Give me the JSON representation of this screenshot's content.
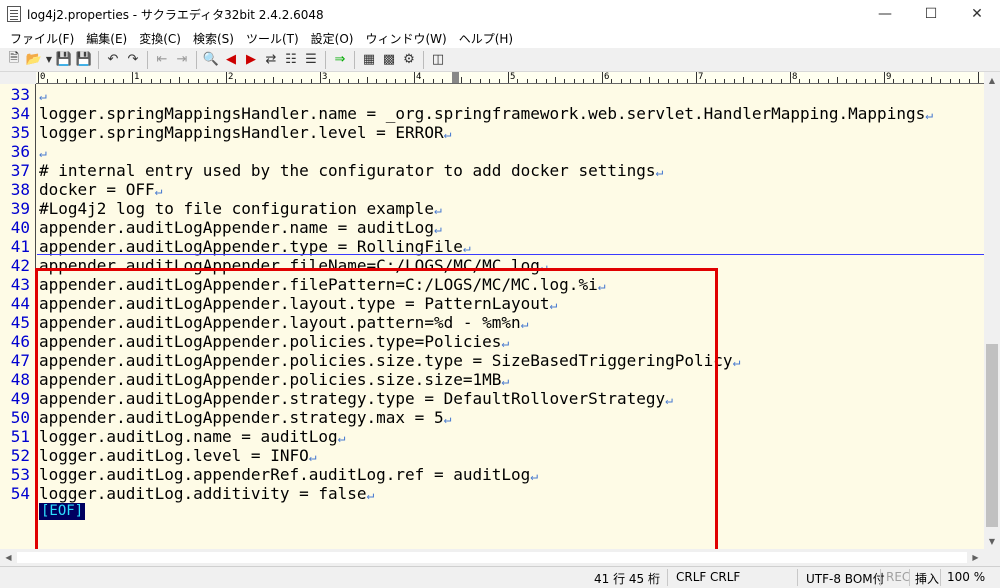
{
  "window": {
    "title": "log4j2.properties - サクラエディタ32bit 2.4.2.6048",
    "minimize_icon": "minimize-icon",
    "maximize_icon": "maximize-icon",
    "close_icon": "close-icon"
  },
  "menu": [
    {
      "label": "ファイル(F)"
    },
    {
      "label": "編集(E)"
    },
    {
      "label": "変換(C)"
    },
    {
      "label": "検索(S)"
    },
    {
      "label": "ツール(T)"
    },
    {
      "label": "設定(O)"
    },
    {
      "label": "ウィンドウ(W)"
    },
    {
      "label": "ヘルプ(H)"
    }
  ],
  "toolbar": {
    "icons": [
      "new-file-icon",
      "open-file-icon",
      "dropdown-icon",
      "save-icon",
      "save-as-icon",
      "undo-icon",
      "redo-icon",
      "jump-back-icon",
      "jump-forward-icon",
      "search-icon",
      "search-prev-icon",
      "search-next-icon",
      "replace-icon",
      "grep-icon",
      "outline-icon",
      "compare-icon",
      "function-list-icon",
      "tag-jump-icon",
      "settings-icon"
    ]
  },
  "ruler": {
    "labels": [
      "0",
      "1",
      "2",
      "3",
      "4",
      "5",
      "6",
      "7",
      "8",
      "9"
    ]
  },
  "editor": {
    "eof_label": "[EOF]",
    "crlf_mark": "↵",
    "lines": [
      {
        "num": "33",
        "text": ""
      },
      {
        "num": "34",
        "text": "logger.springMappingsHandler.name = _org.springframework.web.servlet.HandlerMapping.Mappings"
      },
      {
        "num": "35",
        "text": "logger.springMappingsHandler.level = ERROR"
      },
      {
        "num": "36",
        "text": ""
      },
      {
        "num": "37",
        "text": "# internal entry used by the configurator to add docker settings"
      },
      {
        "num": "38",
        "text": "docker = OFF"
      },
      {
        "num": "39",
        "text": "#Log4j2 log to file configuration example"
      },
      {
        "num": "40",
        "text": "appender.auditLogAppender.name = auditLog"
      },
      {
        "num": "41",
        "text": "appender.auditLogAppender.type = RollingFile"
      },
      {
        "num": "42",
        "text": "appender.auditLogAppender.fileName=C:/LOGS/MC/MC.log"
      },
      {
        "num": "43",
        "text": "appender.auditLogAppender.filePattern=C:/LOGS/MC/MC.log.%i"
      },
      {
        "num": "44",
        "text": "appender.auditLogAppender.layout.type = PatternLayout"
      },
      {
        "num": "45",
        "text": "appender.auditLogAppender.layout.pattern=%d - %m%n"
      },
      {
        "num": "46",
        "text": "appender.auditLogAppender.policies.type=Policies"
      },
      {
        "num": "47",
        "text": "appender.auditLogAppender.policies.size.type = SizeBasedTriggeringPolicy"
      },
      {
        "num": "48",
        "text": "appender.auditLogAppender.policies.size.size=1MB"
      },
      {
        "num": "49",
        "text": "appender.auditLogAppender.strategy.type = DefaultRolloverStrategy"
      },
      {
        "num": "50",
        "text": "appender.auditLogAppender.strategy.max = 5"
      },
      {
        "num": "51",
        "text": "logger.auditLog.name = auditLog"
      },
      {
        "num": "52",
        "text": "logger.auditLog.level = INFO"
      },
      {
        "num": "53",
        "text": "logger.auditLog.appenderRef.auditLog.ref = auditLog"
      },
      {
        "num": "54",
        "text": "logger.auditLog.additivity = false"
      }
    ]
  },
  "statusbar": {
    "position": "41 行  45 桁",
    "line_ending": "CRLF",
    "line_ending_2": "CRLF",
    "encoding": "UTF-8 BOM付",
    "rec": "REC",
    "insert_mode": "挿入",
    "zoom": "100 %"
  },
  "colors": {
    "editor_background": "#fefbe6",
    "line_number": "#0000d0",
    "crlf_mark": "#4a7bd0",
    "highlight_border": "#e00000",
    "eof_background": "#000060",
    "eof_text": "#2de0ff"
  }
}
